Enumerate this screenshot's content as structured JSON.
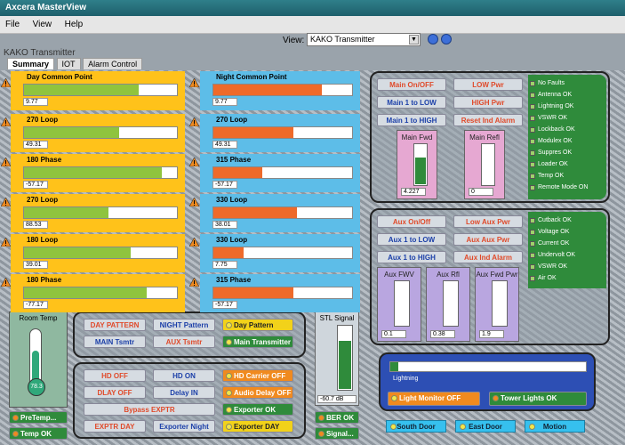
{
  "window": {
    "title": "Axcera MasterView"
  },
  "menu": [
    "File",
    "View",
    "Help"
  ],
  "view": {
    "label": "View:",
    "selected": "KAKO Transmitter"
  },
  "section_title": "KAKO Transmitter",
  "tabs": [
    "Summary",
    "IOT",
    "Alarm Control"
  ],
  "day_common": {
    "label": "Day Common Point",
    "value": "9.77"
  },
  "night_common": {
    "label": "Night Common Point",
    "value": "9.77"
  },
  "day_points": [
    {
      "label": "270 Loop",
      "value": "49.31"
    },
    {
      "label": "180 Phase",
      "value": "-57.17"
    },
    {
      "label": "270 Loop",
      "value": "88.53"
    },
    {
      "label": "180 Loop",
      "value": "39.01"
    },
    {
      "label": "180 Phase",
      "value": "-77.17"
    }
  ],
  "night_points": [
    {
      "label": "270 Loop",
      "value": "49.31"
    },
    {
      "label": "315 Phase",
      "value": "-57.17"
    },
    {
      "label": "330 Loop",
      "value": "38.01"
    },
    {
      "label": "330 Loop",
      "value": "7.75"
    },
    {
      "label": "315 Phase",
      "value": "-57.17"
    }
  ],
  "room_temp": {
    "label": "Room Temp",
    "value": "78.3",
    "btn_pre": "PreTemp...",
    "btn_temp": "Temp OK"
  },
  "pattern_panel": {
    "day_pattern_btn": "DAY PATTERN",
    "night_pattern_btn": "NIGHT Pattern",
    "day_pattern_status": "Day Pattern",
    "main_xmtr_btn": "MAIN Tsmtr",
    "aux_xmtr_btn": "AUX Tsmtr",
    "main_transmitter_status": "Main Transmitter"
  },
  "hd_panel": {
    "hd_off_btn": "HD OFF",
    "hd_on_btn": "HD ON",
    "hd_carrier": "HD Carrier OFF",
    "delay_off_btn": "DLAY OFF",
    "delay_in_btn": "Delay IN",
    "audio_delay": "Audio Delay OFF",
    "bypass_btn": "Bypass EXPTR",
    "exporter": "Exporter OK",
    "exporter_day_btn": "EXPTR DAY",
    "exporter_night_btn": "Exporter Night",
    "exporter_day": "Exporter DAY"
  },
  "stl": {
    "label": "STL Signal",
    "value": "-60.7 dB",
    "ber": "BER OK",
    "signal": "Signal..."
  },
  "main_panel": {
    "buttons": [
      "Main On/OFF",
      "Main 1 to LOW",
      "Main 1 to HIGH",
      "LOW Pwr",
      "HIGH Pwr",
      "Reset Ind Alarm"
    ],
    "fwd_title": "Main Fwd",
    "fwd_value": "4.227",
    "ref_title": "Main Refl",
    "ref_value": "0",
    "status": [
      "No Faults",
      "Antenna OK",
      "Lightning OK",
      "VSWR OK",
      "Lockback OK",
      "Modulex OK",
      "Suppres OK",
      "Loader OK",
      "Temp OK",
      "Remote Mode ON"
    ]
  },
  "aux_panel": {
    "buttons": [
      "Aux On/Off",
      "Aux 1 to LOW",
      "Aux 1 to HIGH",
      "Low Aux Pwr",
      "Aux Aux Pwr",
      "Aux Ind Alarm"
    ],
    "meters": [
      {
        "title": "Aux FWV",
        "value": "0.1"
      },
      {
        "title": "Aux Rfl",
        "value": "0.38"
      },
      {
        "title": "Aux Fwd Pwr",
        "value": "1.9"
      }
    ],
    "status": [
      "Cutback OK",
      "Voltage OK",
      "Current OK",
      "Undervolt OK",
      "VSWR OK",
      "Air OK"
    ]
  },
  "monitor": {
    "bar_label": "Lightning",
    "light_monitor": "Light Monitor OFF",
    "tower_lights": "Tower Lights OK"
  },
  "bottom_buttons": [
    "South Door",
    "East Door",
    "Motion"
  ]
}
